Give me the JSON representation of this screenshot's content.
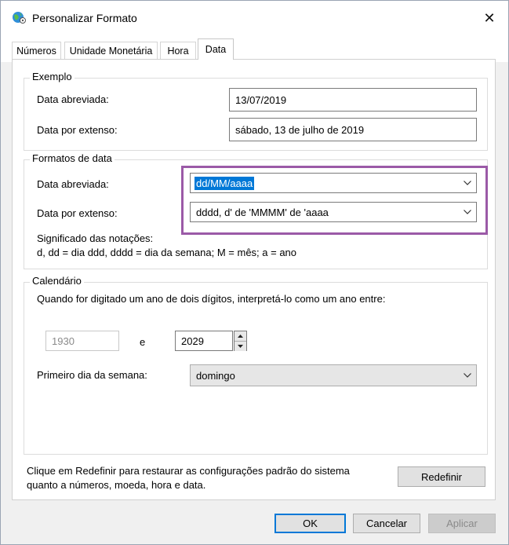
{
  "window": {
    "title": "Personalizar Formato",
    "close_glyph": "✕"
  },
  "tabs": [
    {
      "label": "Números"
    },
    {
      "label": "Unidade Monetária"
    },
    {
      "label": "Hora"
    },
    {
      "label": "Data",
      "active": true
    }
  ],
  "exemplo": {
    "group_label": "Exemplo",
    "short_label": "Data abreviada:",
    "short_value": "13/07/2019",
    "long_label": "Data por extenso:",
    "long_value": "sábado, 13 de julho de 2019"
  },
  "formatos": {
    "group_label": "Formatos de data",
    "short_label": "Data abreviada:",
    "short_value": "dd/MM/aaaa",
    "long_label": "Data por extenso:",
    "long_value": "dddd, d' de 'MMMM' de 'aaaa",
    "notation_title": "Significado das notações:",
    "notation_text": "d, dd = dia  ddd, dddd = dia da semana;  M = mês;  a = ano"
  },
  "calendario": {
    "group_label": "Calendário",
    "two_digit_text": "Quando for digitado um ano de dois dígitos, interpretá-lo como um ano entre:",
    "year_start": "1930",
    "conjunction": "e",
    "year_end": "2029",
    "first_day_label": "Primeiro dia da semana:",
    "first_day_value": "domingo"
  },
  "reset": {
    "text_line1": "Clique em Redefinir para restaurar as configurações padrão do sistema",
    "text_line2": "quanto a números, moeda, hora e data.",
    "button_label": "Redefinir"
  },
  "footer": {
    "ok_label": "OK",
    "cancel_label": "Cancelar",
    "apply_label": "Aplicar"
  },
  "colors": {
    "accent": "#0078d7",
    "highlight_frame": "#9b5aa7"
  }
}
